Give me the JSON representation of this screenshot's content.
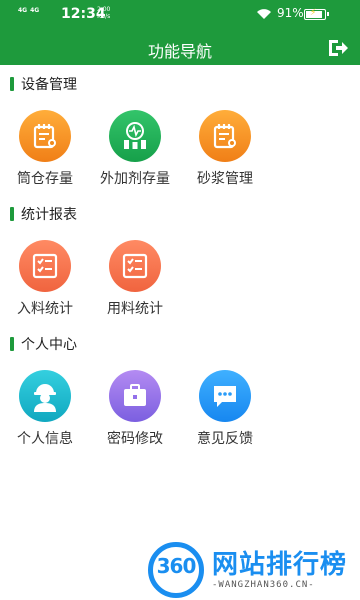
{
  "status_bar": {
    "network_1": "4G",
    "network_2": "4G",
    "time": "12:34",
    "speed_value": "2.00",
    "speed_unit": "KB/s",
    "battery_percent": "91%"
  },
  "header": {
    "title": "功能导航"
  },
  "sections": [
    {
      "title": "设备管理",
      "items": [
        {
          "label": "筒仓存量",
          "icon": "silo-report-icon",
          "color": "#f5911f"
        },
        {
          "label": "外加剂存量",
          "icon": "admixture-gauge-icon",
          "color": "#22b058"
        },
        {
          "label": "砂浆管理",
          "icon": "mortar-report-icon",
          "color": "#f5911f"
        }
      ]
    },
    {
      "title": "统计报表",
      "items": [
        {
          "label": "入料统计",
          "icon": "checklist-icon",
          "color": "#f5714c"
        },
        {
          "label": "用料统计",
          "icon": "checklist-icon",
          "color": "#f5714c"
        }
      ]
    },
    {
      "title": "个人中心",
      "items": [
        {
          "label": "个人信息",
          "icon": "worker-avatar-icon",
          "color": "#1fbcd0"
        },
        {
          "label": "密码修改",
          "icon": "briefcase-icon",
          "color": "#9370ea"
        },
        {
          "label": "意见反馈",
          "icon": "chat-bubble-icon",
          "color": "#2a9cf8"
        }
      ]
    }
  ],
  "watermark": {
    "logo_text": "360",
    "title": "网站排行榜",
    "subtitle": "-WANGZHAN360.CN-"
  },
  "colors": {
    "brand_green": "#1e9a3c",
    "watermark_blue": "#1a8ef0"
  }
}
